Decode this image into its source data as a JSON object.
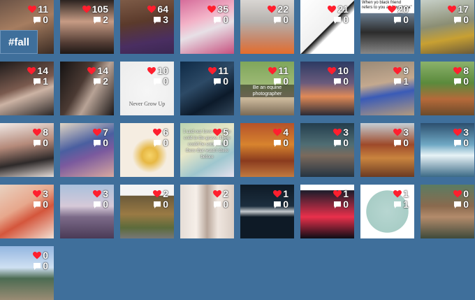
{
  "hashtag": {
    "label": "#fall"
  },
  "icons": {
    "like": "heart-icon",
    "comment": "comment-bubble-icon",
    "like_color": "#ff1f2e"
  },
  "tiles": [
    {
      "likes": "11",
      "comments": "0",
      "bg": "linear-gradient(160deg,#6b5346,#a67d60 45%,#3a2b23)"
    },
    {
      "likes": "105",
      "comments": "2",
      "bg": "linear-gradient(180deg,#2b2320,#c69b84 40%,#513b33 80%,#1e1816)"
    },
    {
      "likes": "64",
      "comments": "3",
      "bg": "linear-gradient(170deg,#7d5b47,#5b3a2b 40%,#4a2e61 75%,#3b2752)"
    },
    {
      "likes": "35",
      "comments": "0",
      "bg": "linear-gradient(160deg,#d56c9a,#f3b2c7 35%,#e7e0e6 55%,#c7507e)"
    },
    {
      "likes": "22",
      "comments": "0",
      "bg": "linear-gradient(180deg,#d9d6d3,#b5b1ad 40%,#c98565 75%,#e46d2b)"
    },
    {
      "likes": "21",
      "comments": "0",
      "bg": "linear-gradient(135deg,#ffffff,#f0f0f0 50%,#111 51%,#fff 60%)"
    },
    {
      "likes": "20",
      "comments": "0",
      "bg": "linear-gradient(180deg,#ffffff 0,#ffffff 24%,#6a7c8f 25%,#2c2c2c 60%,#888 100%)",
      "top_text": "When yo black friend refers to you as \"my nigga\""
    },
    {
      "likes": "17",
      "comments": "0",
      "bg": "linear-gradient(170deg,#c7d0c8,#8b8e74 45%,#c8a032 70%,#6a5a3a)"
    },
    {
      "likes": "14",
      "comments": "1",
      "bg": "linear-gradient(160deg,#1d1a1a,#7a5a4e 45%,#ccb3a4 60%,#2a2626)"
    },
    {
      "likes": "14",
      "comments": "2",
      "bg": "linear-gradient(120deg,#141212,#4b3a33 40%,#b8a396 60%,#1a1616)"
    },
    {
      "likes": "10",
      "comments": "0",
      "bg": "radial-gradient(circle at 50% 55%,#f6f6f6,#ececec)",
      "never_text": "Never Grow Up"
    },
    {
      "likes": "11",
      "comments": "0",
      "bg": "linear-gradient(150deg,#0e2a46,#2d4a66 40%,#0c1a2a 70%,#31465a)"
    },
    {
      "likes": "11",
      "comments": "0",
      "bg": "linear-gradient(180deg,#7fa65b,#9bb873 40%,#c9b69a 70%,#7a6a55)",
      "caption": "Be an equine photographer"
    },
    {
      "likes": "10",
      "comments": "0",
      "bg": "linear-gradient(180deg,#2c3a63,#6b5b7c 40%,#e08a57 65%,#2a2a35)"
    },
    {
      "likes": "9",
      "comments": "1",
      "bg": "linear-gradient(170deg,#9a8a77,#c4a98f 40%,#3a5bb7 60%,#b39a7f)"
    },
    {
      "likes": "8",
      "comments": "0",
      "bg": "linear-gradient(180deg,#8bb26b,#5b8a3c 40%,#b56a3a 70%,#6b4a2a)"
    },
    {
      "likes": "8",
      "comments": "0",
      "bg": "linear-gradient(170deg,#f0e9e6,#b58a7a 40%,#2e2a2a 70%,#e6dcd8)"
    },
    {
      "likes": "7",
      "comments": "0",
      "bg": "linear-gradient(160deg,#e2d6c4,#4a5fa0 40%,#7b5a9e 60%,#d8a9a0)"
    },
    {
      "likes": "6",
      "comments": "0",
      "bg": "radial-gradient(circle at 55% 60%,#f6d46a 0,#e7b844 18%,#f5ede1 40%,#f5ede1)"
    },
    {
      "likes": "5",
      "comments": "0",
      "bg": "linear-gradient(150deg,#b9d4b0,#e8e7c8 40%,#9ec6ce 70%,#e7e1ee)",
      "quote": "I said our love would be cold in the grave. There could be something there that wasn't there before"
    },
    {
      "likes": "4",
      "comments": "0",
      "bg": "linear-gradient(180deg,#b5522a,#d7832e 40%,#8a3b1e 70%,#c27a3f)"
    },
    {
      "likes": "3",
      "comments": "0",
      "bg": "linear-gradient(180deg,#233d4d,#4f6d73 40%,#7b6a5c 60%,#253442)"
    },
    {
      "likes": "3",
      "comments": "0",
      "bg": "linear-gradient(180deg,#c5cfd6,#9e4a2a 40%,#c9843f 65%,#6b3a22)"
    },
    {
      "likes": "3",
      "comments": "0",
      "bg": "linear-gradient(180deg,#2c4f6e,#6fa8c4 40%,#e8f3f6 60%,#3b6a86)"
    },
    {
      "likes": "3",
      "comments": "0",
      "bg": "linear-gradient(150deg,#e9d2c1,#e7a78c 40%,#d4563c 60%,#f2e0d3)"
    },
    {
      "likes": "3",
      "comments": "0",
      "bg": "linear-gradient(180deg,#a9c0dc,#d6c9d8 40%,#7c6b89 60%,#4a3a56)"
    },
    {
      "likes": "2",
      "comments": "0",
      "bg": "linear-gradient(180deg,#f4f4f4 0,#f4f4f4 20%,#6b5a3a 21%,#9a7a44 55%,#5c6b3b 80%,#777 100%)"
    },
    {
      "likes": "2",
      "comments": "0",
      "bg": "linear-gradient(90deg,#e5ddd6,#f6efe9 30%,#b8a69a 50%,#efe6df 70%,#d9cdc4)"
    },
    {
      "likes": "1",
      "comments": "0",
      "bg": "linear-gradient(180deg,#0e1a26,#1c2e3e 40%,#c4c8cc 50%,#0e1a26 60%)"
    },
    {
      "likes": "1",
      "comments": "0",
      "bg": "linear-gradient(180deg,#ffffff 0,#ffffff 10%,#1c1c2a 11%,#e9304b 60%,#0d0d16 100%)"
    },
    {
      "likes": "1",
      "comments": "1",
      "bg": "radial-gradient(circle at 50% 50%,#b7d6d1 0,#a8cdc6 55%,#ffffff 56%)"
    },
    {
      "likes": "0",
      "comments": "0",
      "bg": "linear-gradient(180deg,#5b7c62,#8a6a4e 40%,#b38b6b 60%,#3f4a3b)"
    },
    {
      "likes": "0",
      "comments": "0",
      "bg": "linear-gradient(180deg,#94b6e0,#cfe0f2 40%,#4c6b52 60%,#9a8c74)"
    }
  ]
}
